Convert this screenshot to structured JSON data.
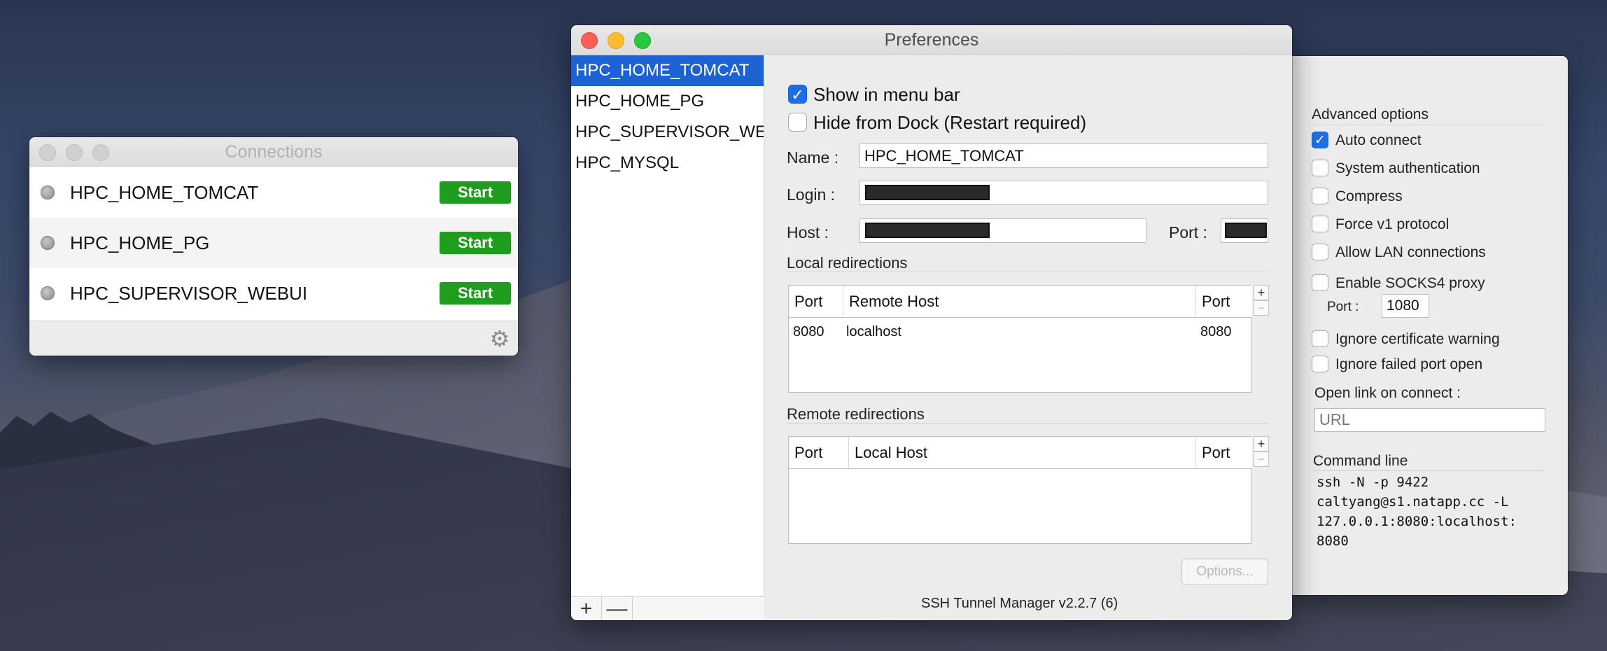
{
  "connections_window": {
    "title": "Connections",
    "rows": [
      {
        "name": "HPC_HOME_TOMCAT",
        "button": "Start"
      },
      {
        "name": "HPC_HOME_PG",
        "button": "Start"
      },
      {
        "name": "HPC_SUPERVISOR_WEBUI",
        "button": "Start"
      }
    ],
    "gear_icon": "gear-icon"
  },
  "preferences_window": {
    "title": "Preferences",
    "sidebar": {
      "items": [
        {
          "label": "HPC_HOME_TOMCAT",
          "selected": true
        },
        {
          "label": "HPC_HOME_PG",
          "selected": false
        },
        {
          "label": "HPC_SUPERVISOR_WEE",
          "selected": false
        },
        {
          "label": "HPC_MYSQL",
          "selected": false
        }
      ],
      "add": "+",
      "remove": "—"
    },
    "show_in_menu_bar": {
      "label": "Show in menu bar",
      "checked": true
    },
    "hide_from_dock": {
      "label": "Hide from Dock (Restart required)",
      "checked": false
    },
    "name": {
      "label": "Name :",
      "value": "HPC_HOME_TOMCAT"
    },
    "login": {
      "label": "Login :"
    },
    "host": {
      "label": "Host :"
    },
    "port": {
      "label": "Port :"
    },
    "local_redirections": {
      "label": "Local redirections",
      "headers": [
        "Port",
        "Remote Host",
        "Port"
      ],
      "rows": [
        [
          "8080",
          "localhost",
          "8080"
        ]
      ]
    },
    "remote_redirections": {
      "label": "Remote redirections",
      "headers": [
        "Port",
        "Local Host",
        "Port"
      ],
      "rows": []
    },
    "options_button": "Options...",
    "version": "SSH Tunnel Manager v2.2.7 (6)"
  },
  "advanced": {
    "title": "Advanced options",
    "options": [
      {
        "label": "Auto connect",
        "checked": true
      },
      {
        "label": "System authentication",
        "checked": false
      },
      {
        "label": "Compress",
        "checked": false
      },
      {
        "label": "Force v1 protocol",
        "checked": false
      },
      {
        "label": "Allow LAN connections",
        "checked": false
      },
      {
        "label": "Enable SOCKS4 proxy",
        "checked": false
      }
    ],
    "socks_port_label": "Port :",
    "socks_port_value": "1080",
    "ignore_cert": {
      "label": "Ignore certificate warning",
      "checked": false
    },
    "ignore_failed": {
      "label": "Ignore failed port open",
      "checked": false
    },
    "open_link_label": "Open link on connect :",
    "url_placeholder": "URL",
    "command_line_label": "Command line",
    "command_line": "ssh -N -p 9422\ncaltyang@s1.natapp.cc -L\n127.0.0.1:8080:localhost:\n8080"
  }
}
